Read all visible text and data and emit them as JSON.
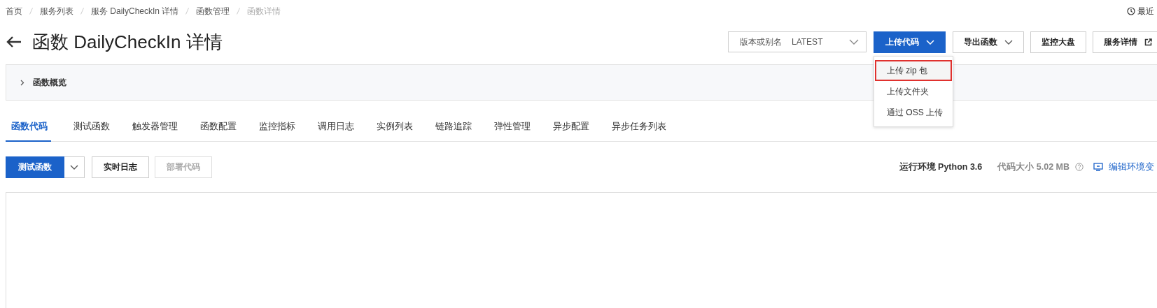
{
  "breadcrumb": [
    {
      "label": "首页",
      "current": false
    },
    {
      "label": "服务列表",
      "current": false
    },
    {
      "label": "服务 DailyCheckIn 详情",
      "current": false
    },
    {
      "label": "函数管理",
      "current": false
    },
    {
      "label": "函数详情",
      "current": true
    }
  ],
  "recent": "最近",
  "title": "函数 DailyCheckIn 详情",
  "version_select": {
    "label": "版本或别名",
    "value": "LATEST"
  },
  "header_buttons": [
    {
      "label": "上传代码",
      "kind": "primary-dropdown"
    },
    {
      "label": "导出函数",
      "kind": "dropdown"
    },
    {
      "label": "监控大盘",
      "kind": "plain"
    },
    {
      "label": "服务详情",
      "kind": "external"
    }
  ],
  "upload_menu": [
    {
      "label": "上传 zip 包",
      "highlighted": true
    },
    {
      "label": "上传文件夹",
      "highlighted": false
    },
    {
      "label": "通过 OSS 上传",
      "highlighted": false
    }
  ],
  "overview": {
    "label": "函数概览",
    "expanded": false
  },
  "tabs": [
    {
      "label": "函数代码",
      "selected": true
    },
    {
      "label": "测试函数",
      "selected": false
    },
    {
      "label": "触发器管理",
      "selected": false
    },
    {
      "label": "函数配置",
      "selected": false
    },
    {
      "label": "监控指标",
      "selected": false
    },
    {
      "label": "调用日志",
      "selected": false
    },
    {
      "label": "实例列表",
      "selected": false
    },
    {
      "label": "链路追踪",
      "selected": false
    },
    {
      "label": "弹性管理",
      "selected": false
    },
    {
      "label": "异步配置",
      "selected": false
    },
    {
      "label": "异步任务列表",
      "selected": false
    }
  ],
  "toolbar": [
    {
      "label": "测试函数",
      "kind": "primary-split",
      "disabled": false
    },
    {
      "label": "实时日志",
      "kind": "plain",
      "disabled": false
    },
    {
      "label": "部署代码",
      "kind": "plain",
      "disabled": true
    }
  ],
  "runtime": "运行环境 Python 3.6",
  "code_size": "代码大小 5.02 MB",
  "edit_env": "编辑环境变"
}
